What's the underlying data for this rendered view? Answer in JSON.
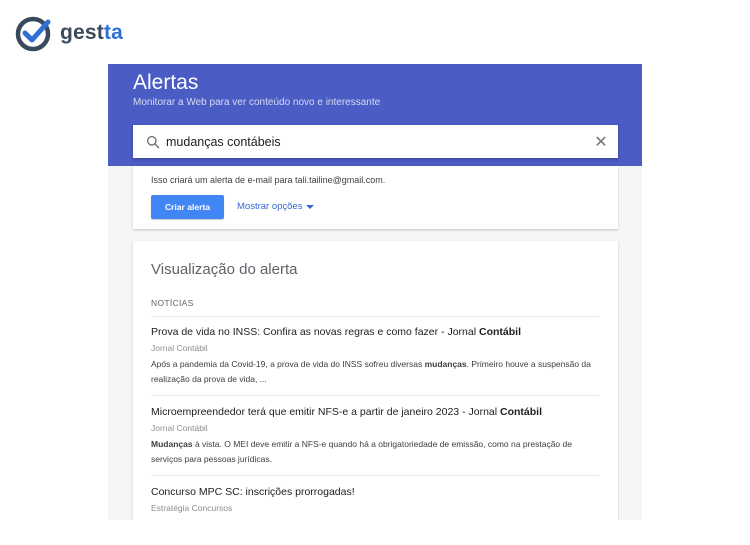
{
  "brand": {
    "name_prefix": "gest",
    "name_suffix": "ta",
    "accent": "#2f6fd6",
    "text_color": "#3a4a5c"
  },
  "header": {
    "title": "Alertas",
    "subtitle": "Monitorar a Web para ver conteúdo novo e interessante",
    "color": "#4b5cc4"
  },
  "search": {
    "value": "mudanças contábeis"
  },
  "create": {
    "note": "Isso criará um alerta de e-mail para tali.tailine@gmail.com.",
    "create_label": "Criar alerta",
    "options_label": "Mostrar opções"
  },
  "preview": {
    "title": "Visualização do alerta",
    "section": "NOTÍCIAS",
    "items": [
      {
        "title": "Prova de vida no INSS: Confira as novas regras e como fazer - Jornal ",
        "title_bold": "Contábil",
        "source": "Jornal Contábil",
        "snippet_a": "Após a pandemia da Covid-19, a prova de vida do INSS sofreu diversas ",
        "snippet_bold": "mudanças",
        "snippet_b": ". Primeiro houve a suspensão da realização da prova de vida, ..."
      },
      {
        "title": "Microempreendedor terá que emitir NFS-e a partir de janeiro 2023 - Jornal ",
        "title_bold": "Contábil",
        "source": "Jornal Contábil",
        "snippet_a": "",
        "snippet_bold": "Mudanças",
        "snippet_b": " à vista. O MEI deve emitir a NFS-e quando há a obrigatoriedade de emissão, como na prestação de serviços para pessoas jurídicas."
      },
      {
        "title": "Concurso MPC SC: inscrições prorrogadas!",
        "title_bold": "",
        "source": "Estratégia Concursos",
        "snippet_a": "",
        "snippet_bold": "",
        "snippet_b": ""
      }
    ]
  }
}
